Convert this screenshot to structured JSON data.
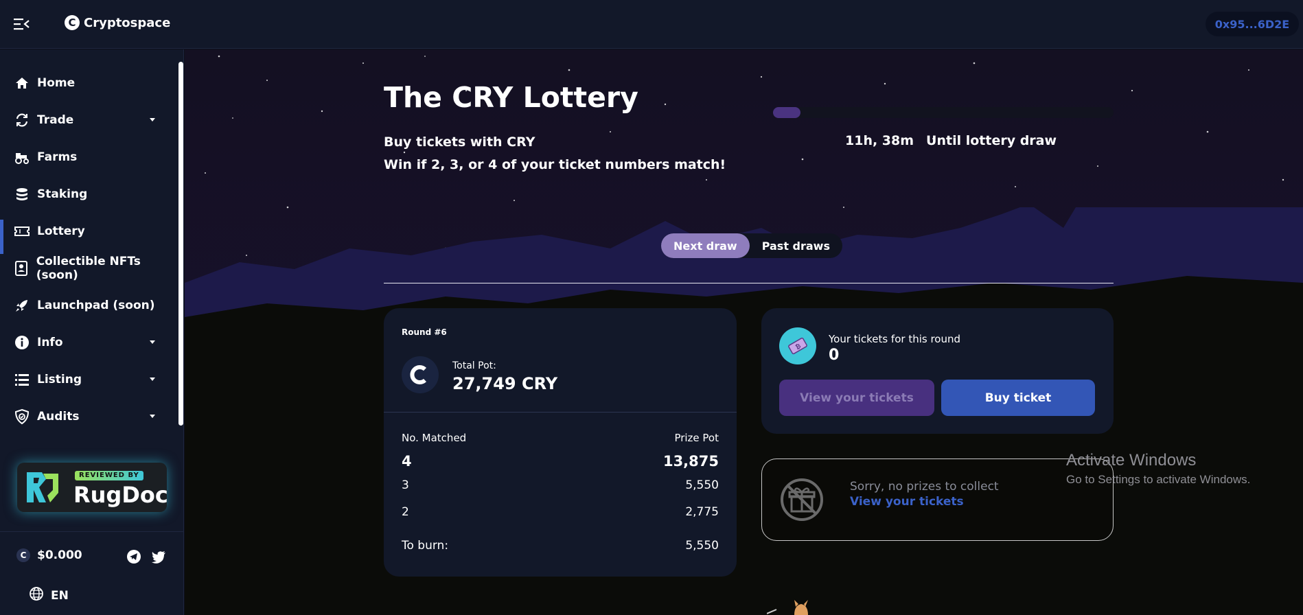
{
  "topbar": {
    "logo_text": "Cryptospace",
    "logo_mark": "C",
    "wallet": "0x95...6D2E"
  },
  "sidebar": {
    "items": [
      {
        "label": "Home",
        "icon": "home-icon"
      },
      {
        "label": "Trade",
        "icon": "refresh-icon",
        "has_caret": true
      },
      {
        "label": "Farms",
        "icon": "tractor-icon"
      },
      {
        "label": "Staking",
        "icon": "database-icon"
      },
      {
        "label": "Lottery",
        "icon": "ticket-icon",
        "active": true
      },
      {
        "label": "Collectible NFTs (soon)",
        "icon": "id-card-icon"
      },
      {
        "label": "Launchpad (soon)",
        "icon": "rocket-icon"
      },
      {
        "label": "Info",
        "icon": "info-icon",
        "has_caret": true
      },
      {
        "label": "Listing",
        "icon": "list-icon",
        "has_caret": true
      },
      {
        "label": "Audits",
        "icon": "shield-check-icon",
        "has_caret": true
      }
    ],
    "rugdoc": {
      "reviewed": "REVIEWED BY",
      "name": "RugDoc"
    },
    "price": "$0.000",
    "price_mark": "C",
    "language": "EN"
  },
  "lottery": {
    "title": "The CRY Lottery",
    "subtitle_1": "Buy tickets with CRY",
    "subtitle_2": "Win if 2, 3, or 4 of your ticket numbers match!",
    "progress_fraction": 0.08,
    "countdown_time": "11h, 38m",
    "countdown_label": "Until lottery draw",
    "tabs": [
      {
        "label": "Next draw",
        "active": true
      },
      {
        "label": "Past draws",
        "active": false
      }
    ]
  },
  "round_card": {
    "round": "Round #6",
    "pot_label": "Total Pot:",
    "pot_value": "27,749 CRY",
    "header_left": "No. Matched",
    "header_right": "Prize Pot",
    "rows": [
      {
        "matched": "4",
        "prize": "13,875"
      },
      {
        "matched": "3",
        "prize": "5,550"
      },
      {
        "matched": "2",
        "prize": "2,775"
      }
    ],
    "burn_label": "To burn:",
    "burn_value": "5,550"
  },
  "tickets_card": {
    "label": "Your tickets for this round",
    "value": "0",
    "view_button": "View your tickets",
    "buy_button": "Buy ticket"
  },
  "prizes_card": {
    "message": "Sorry, no prizes to collect",
    "link": "View your tickets"
  },
  "watermark": {
    "title": "Activate Windows",
    "subtitle": "Go to Settings to activate Windows."
  },
  "colors": {
    "accent": "#3b62c9",
    "tab_active": "#8f7dbd",
    "card_bg": "#121829"
  }
}
